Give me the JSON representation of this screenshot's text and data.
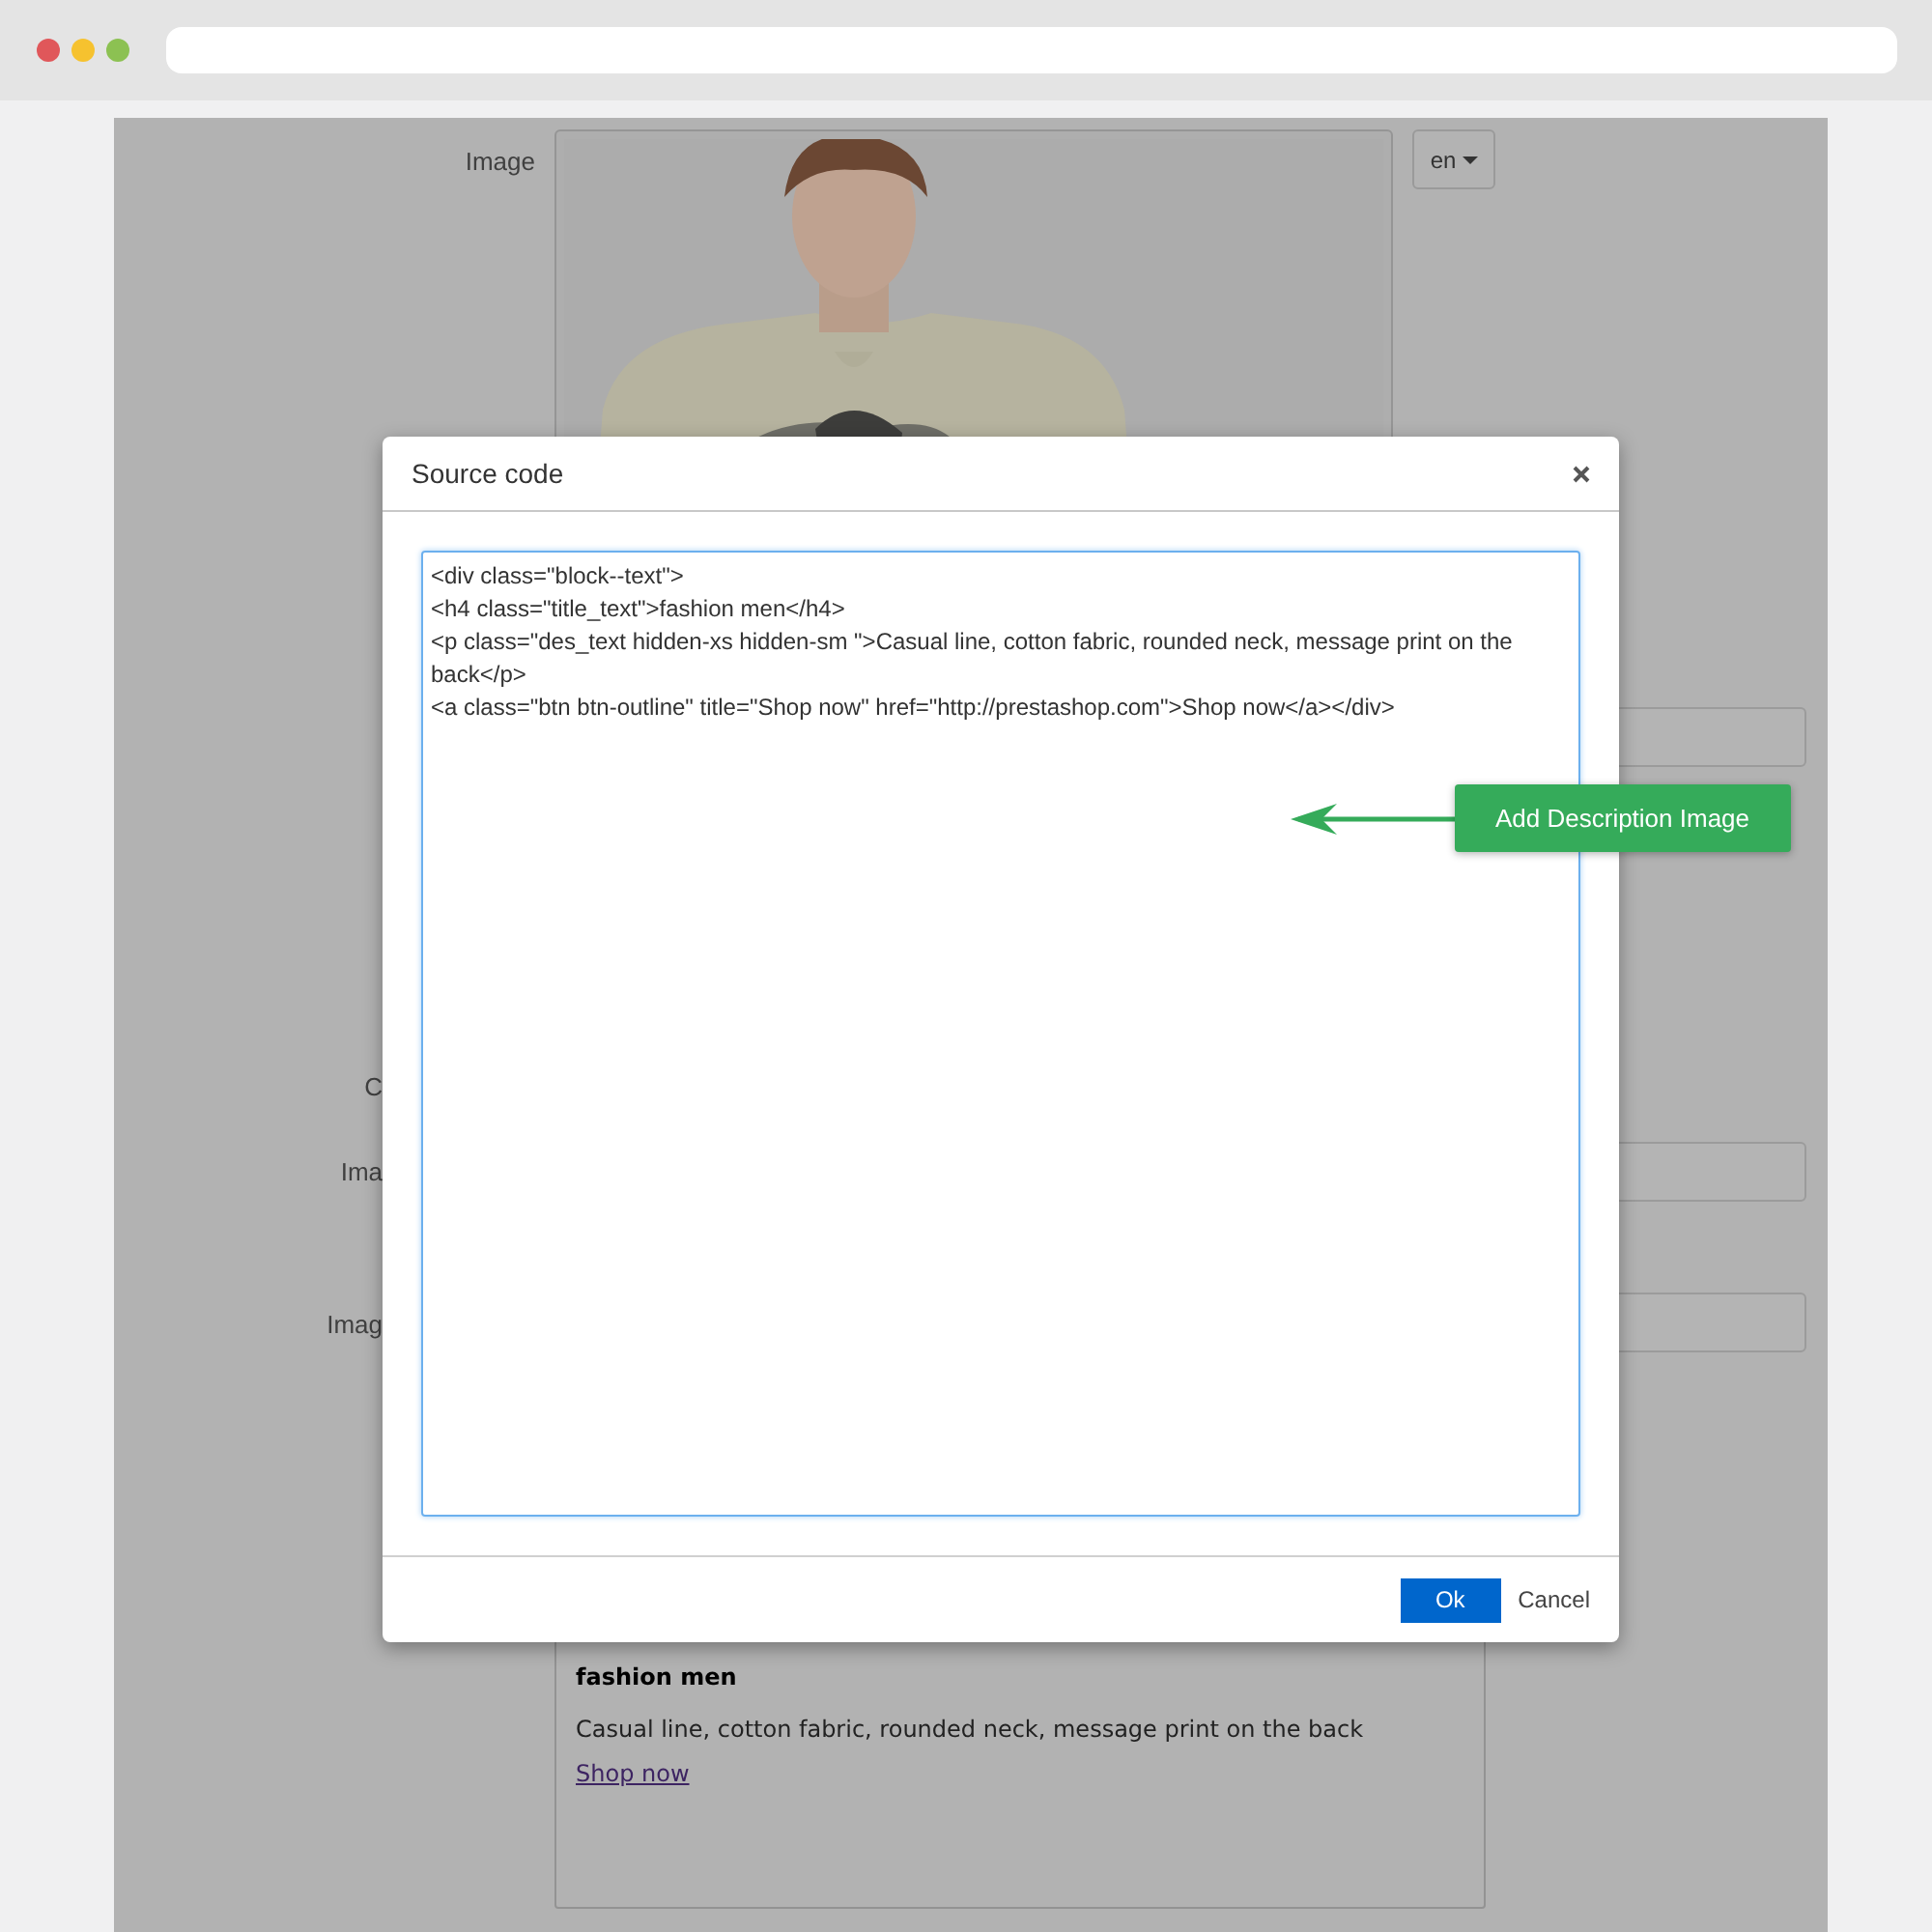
{
  "form": {
    "rows": [
      {
        "label": "Image",
        "language": "en"
      },
      {
        "kind": "field"
      },
      {
        "kind": "label",
        "label": "C"
      },
      {
        "kind": "field",
        "label": "Ima"
      },
      {
        "kind": "field",
        "label": "Imag"
      },
      {
        "kind": "preview",
        "heading": "fashion men",
        "text": "Casual line, cotton fabric, rounded neck, message print on the back",
        "link": "Shop now"
      }
    ]
  },
  "modal": {
    "title": "Source code",
    "code": [
      "<div class=\"block--text\">",
      "<h4 class=\"title_text\">fashion men</h4>",
      "<p class=\"des_text hidden-xs hidden-sm \">Casual line, cotton fabric, rounded neck, message print on the back</p>",
      "<a class=\"btn btn-outline\" title=\"Shop now\" href=\"http://prestashop.com\">Shop now</a></div>"
    ],
    "buttons": [
      {
        "label": "Ok",
        "kind": "primary"
      },
      {
        "label": "Cancel",
        "kind": "plain"
      }
    ]
  },
  "callout": {
    "label": "Add Description Image"
  }
}
